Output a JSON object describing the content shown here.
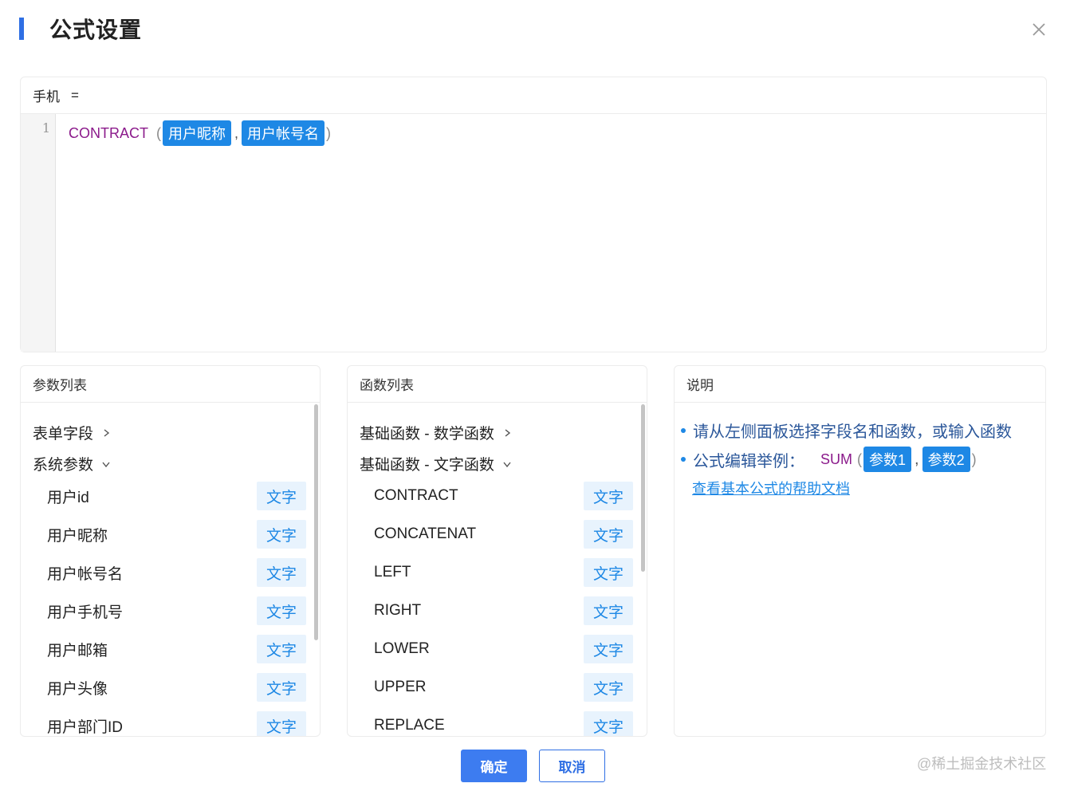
{
  "dialog": {
    "title": "公式设置",
    "close_icon": "close-icon"
  },
  "editor": {
    "field_label": "手机",
    "equals": "=",
    "line_number": "1",
    "formula": {
      "function": "CONTRACT",
      "open_paren": "(",
      "args": [
        "用户昵称",
        "用户帐号名"
      ],
      "separator": ",",
      "close_paren": ")"
    }
  },
  "params_panel": {
    "title": "参数列表",
    "groups": [
      {
        "label": "表单字段",
        "state": "collapsed"
      },
      {
        "label": "系统参数",
        "state": "expanded"
      }
    ],
    "items": [
      {
        "name": "用户id",
        "type": "文字"
      },
      {
        "name": "用户昵称",
        "type": "文字"
      },
      {
        "name": "用户帐号名",
        "type": "文字"
      },
      {
        "name": "用户手机号",
        "type": "文字"
      },
      {
        "name": "用户邮箱",
        "type": "文字"
      },
      {
        "name": "用户头像",
        "type": "文字"
      },
      {
        "name": "用户部门ID",
        "type": "文字"
      }
    ]
  },
  "functions_panel": {
    "title": "函数列表",
    "groups": [
      {
        "label": "基础函数 - 数学函数",
        "state": "collapsed"
      },
      {
        "label": "基础函数 - 文字函数",
        "state": "expanded"
      }
    ],
    "items": [
      {
        "name": "CONTRACT",
        "type": "文字"
      },
      {
        "name": "CONCATENAT",
        "type": "文字"
      },
      {
        "name": "LEFT",
        "type": "文字"
      },
      {
        "name": "RIGHT",
        "type": "文字"
      },
      {
        "name": "LOWER",
        "type": "文字"
      },
      {
        "name": "UPPER",
        "type": "文字"
      },
      {
        "name": "REPLACE",
        "type": "文字"
      }
    ]
  },
  "description_panel": {
    "title": "说明",
    "line1": "请从左侧面板选择字段名和函数，或输入函数",
    "line2_prefix": "公式编辑举例：",
    "example": {
      "function": "SUM",
      "open_paren": "(",
      "args": [
        "参数1",
        "参数2"
      ],
      "separator": ",",
      "close_paren": ")"
    },
    "help_link": "查看基本公式的帮助文档"
  },
  "footer": {
    "ok_label": "确定",
    "cancel_label": "取消"
  },
  "watermark": "@稀土掘金技术社区",
  "colors": {
    "accent": "#2f6fe4",
    "chip": "#1e88e5",
    "tag_bg": "#e8f3fd",
    "function_name": "#8b1a8b"
  }
}
